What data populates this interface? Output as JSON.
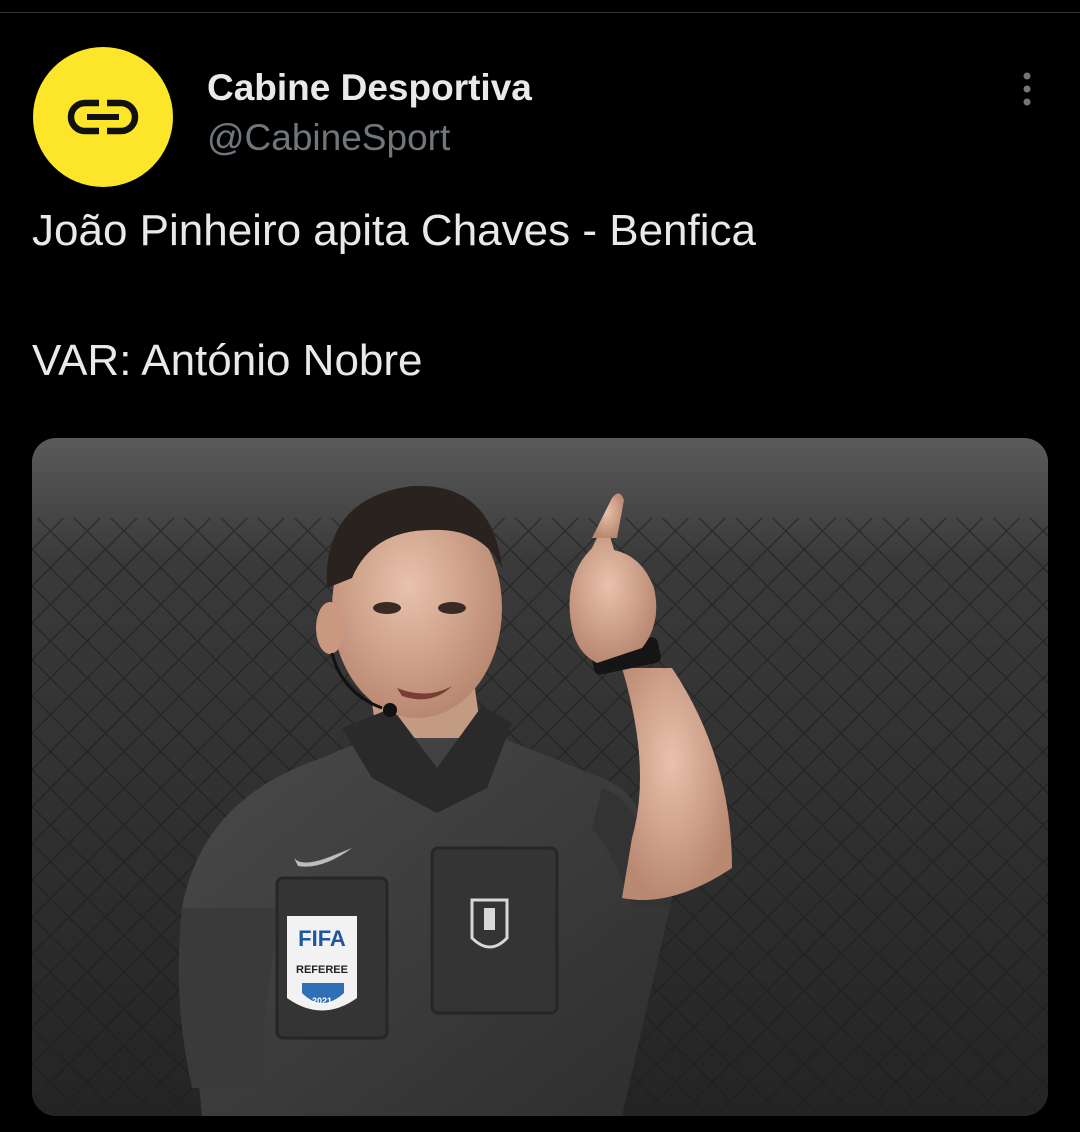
{
  "tweet": {
    "author": {
      "display_name": "Cabine Desportiva",
      "handle": "@CabineSport",
      "avatar_icon": "cd-logo-icon",
      "avatar_color": "#fde52a"
    },
    "more_icon": "more-vertical-icon",
    "text_lines": [
      "João Pinheiro apita Chaves - Benfica",
      "VAR: António Nobre"
    ],
    "media": {
      "badge_lines": [
        "FIFA",
        "REFEREE",
        "2021"
      ]
    }
  },
  "colors": {
    "background": "#000000",
    "text_primary": "#e7e9ea",
    "text_secondary": "#71767b",
    "avatar_yellow": "#fde52a"
  }
}
